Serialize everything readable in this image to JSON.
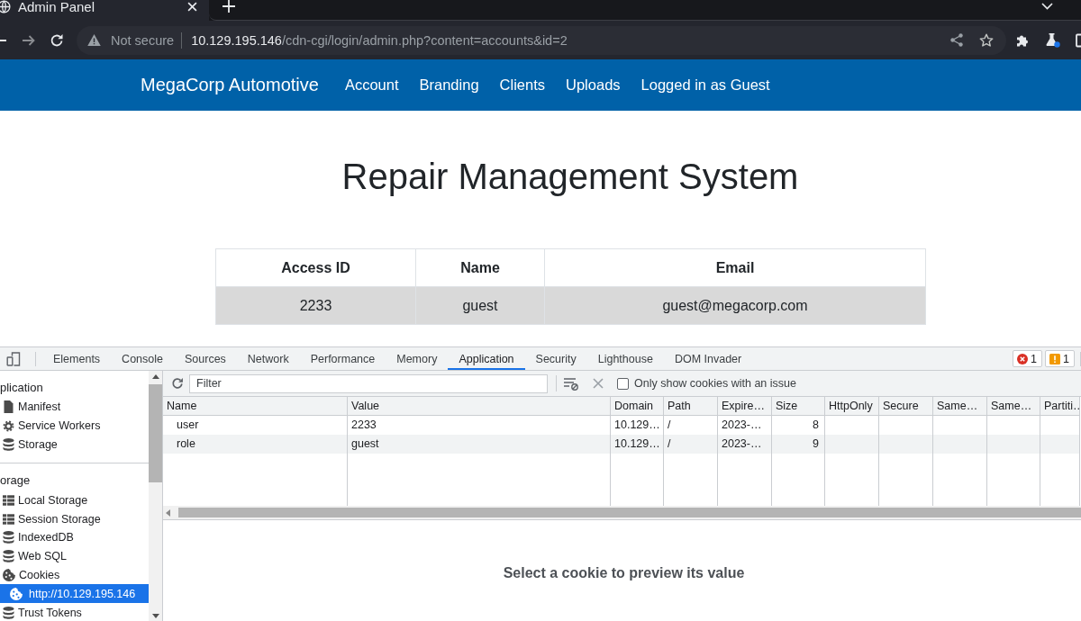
{
  "browser": {
    "tabs": [
      {
        "title": "Admin Panel",
        "selected": true
      }
    ],
    "address_bar": {
      "security_label": "Not secure",
      "host": "10.129.195.146",
      "path": "/cdn-cgi/login/admin.php?content=accounts&id=2"
    }
  },
  "navbar": {
    "brand": "MegaCorp Automotive",
    "links": [
      "Account",
      "Branding",
      "Clients",
      "Uploads",
      "Logged in as Guest"
    ]
  },
  "page": {
    "title": "Repair Management System",
    "table": {
      "columns": [
        "Access ID",
        "Name",
        "Email"
      ],
      "rows": [
        [
          "2233",
          "guest",
          "guest@megacorp.com"
        ]
      ]
    }
  },
  "devtools": {
    "tabs": [
      {
        "label": "Elements",
        "selected": false
      },
      {
        "label": "Console",
        "selected": false
      },
      {
        "label": "Sources",
        "selected": false
      },
      {
        "label": "Network",
        "selected": false
      },
      {
        "label": "Performance",
        "selected": false
      },
      {
        "label": "Memory",
        "selected": false
      },
      {
        "label": "Application",
        "selected": true
      },
      {
        "label": "Security",
        "selected": false
      },
      {
        "label": "Lighthouse",
        "selected": false
      },
      {
        "label": "DOM Invader",
        "selected": false
      }
    ],
    "issue_counters": [
      {
        "kind": "error",
        "count": "1"
      },
      {
        "kind": "warning",
        "count": "1"
      }
    ],
    "sidebar": {
      "sections": [
        {
          "title": "plication",
          "items": [
            {
              "label": "Manifest",
              "kind": "file",
              "selected": false
            },
            {
              "label": "Service Workers",
              "kind": "gear",
              "selected": false
            },
            {
              "label": "Storage",
              "kind": "database",
              "selected": false
            }
          ]
        },
        {
          "title": "orage",
          "items": [
            {
              "label": "Local Storage",
              "kind": "grid",
              "selected": false
            },
            {
              "label": "Session Storage",
              "kind": "grid",
              "selected": false
            },
            {
              "label": "IndexedDB",
              "kind": "database",
              "selected": false
            },
            {
              "label": "Web SQL",
              "kind": "database",
              "selected": false
            },
            {
              "label": "Cookies",
              "kind": "cookie",
              "selected": false,
              "children": [
                {
                  "label": "http://10.129.195.146",
                  "kind": "cookie",
                  "selected": true
                }
              ]
            },
            {
              "label": "Trust Tokens",
              "kind": "database",
              "selected": false
            }
          ]
        }
      ]
    },
    "cookies": {
      "filter": {
        "placeholder": "Filter"
      },
      "issue_checkbox": {
        "label": "Only show cookies with an issue",
        "checked": false
      },
      "columns": [
        {
          "label": "Name",
          "kind": "text"
        },
        {
          "label": "Value",
          "kind": "text"
        },
        {
          "label": "Domain",
          "kind": "text"
        },
        {
          "label": "Path",
          "kind": "text"
        },
        {
          "label": "Expire…",
          "kind": "text"
        },
        {
          "label": "Size",
          "kind": "number"
        },
        {
          "label": "HttpOnly",
          "kind": "text"
        },
        {
          "label": "Secure",
          "kind": "text"
        },
        {
          "label": "Same…",
          "kind": "text"
        },
        {
          "label": "Same…",
          "kind": "text"
        },
        {
          "label": "Partiti…",
          "kind": "text"
        }
      ],
      "rows": [
        [
          "user",
          "2233",
          "10.129…",
          "/",
          "2023-…",
          "8"
        ],
        [
          "role",
          "guest",
          "10.129…",
          "/",
          "2023-…",
          "9"
        ]
      ],
      "preview_message": "Select a cookie to preview its value"
    }
  }
}
